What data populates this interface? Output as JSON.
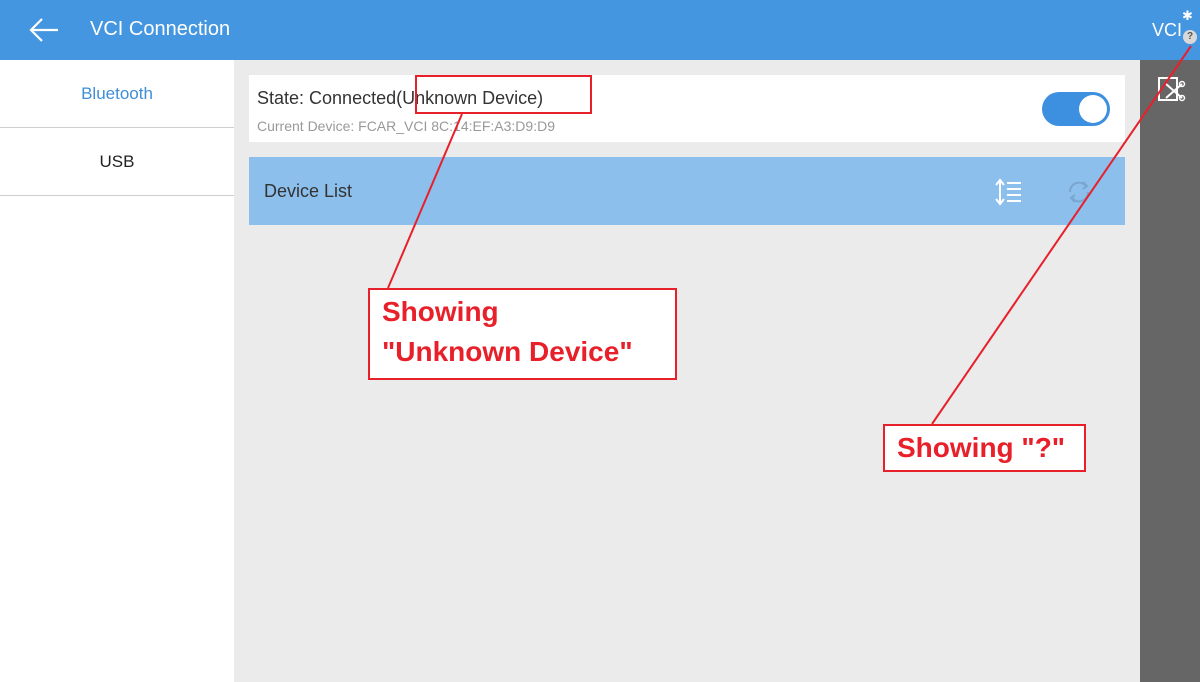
{
  "header": {
    "title": "VCI Connection",
    "back_icon": "arrow-left-icon"
  },
  "right_panel": {
    "vci_label": "VCI",
    "bluetooth_glyph": "✱",
    "status_badge": "?",
    "disconnect_icon": "disconnect-icon"
  },
  "sidebar": {
    "items": [
      {
        "label": "Bluetooth",
        "active": true
      },
      {
        "label": "USB",
        "active": false
      }
    ]
  },
  "state": {
    "text": "State: Connected(Unknown Device)",
    "current_device": "Current Device:  FCAR_VCI 8C:14:EF:A3:D9:D9",
    "toggle_on": true
  },
  "device_list": {
    "title": "Device List",
    "sort_icon": "sort-icon",
    "refresh_icon": "refresh-icon"
  },
  "annotations": {
    "unknown_device": "Showing\n\"Unknown Device\"",
    "question": "Showing \"?\""
  },
  "colors": {
    "accent": "#4596e0",
    "device_header": "#8dbfec",
    "annotation": "#e8202a",
    "right_panel": "#666666"
  }
}
